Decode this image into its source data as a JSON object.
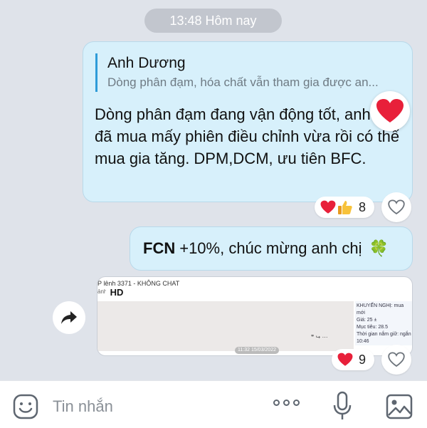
{
  "time_divider": "13:48 Hôm nay",
  "message1": {
    "quote_name": "Anh Dương",
    "quote_text": "Dòng phân đạm, hóa chất vẫn tham gia được an...",
    "text": "Dòng phân đạm đang vận động tốt, anh chị đã mua mấy phiên điều chỉnh vừa rồi có thể mua gia tăng. DPM,DCM, ưu tiên BFC.",
    "reaction_count": "8"
  },
  "message2": {
    "ticker": "FCN",
    "text": "+10%, chúc mừng anh chị",
    "emoji": "🍀"
  },
  "media_message": {
    "badge": "HD",
    "header_text": "P lệnh 3371 - KHÔNG CHAT",
    "sub_text": "ảnh",
    "side_lines": [
      "KHUYẾN NGHỊ: mua mới",
      "Giá: 25 ±",
      "Mục tiêu: 28.5",
      "Thời gian nắm giữ: ngắn",
      "10:46"
    ],
    "date_label": "11:32 15/03/2022",
    "reaction_count": "9"
  },
  "composer": {
    "placeholder": "Tin nhắn"
  },
  "icons": {
    "emoji": "emoji-face-icon",
    "more": "more-dots-icon",
    "mic": "microphone-icon",
    "image": "image-icon",
    "share": "share-arrow-icon",
    "like": "heart-outline-icon"
  },
  "colors": {
    "bubble": "#d7f0fb",
    "accent": "#2e9bd8",
    "heart": "#e8203a"
  }
}
